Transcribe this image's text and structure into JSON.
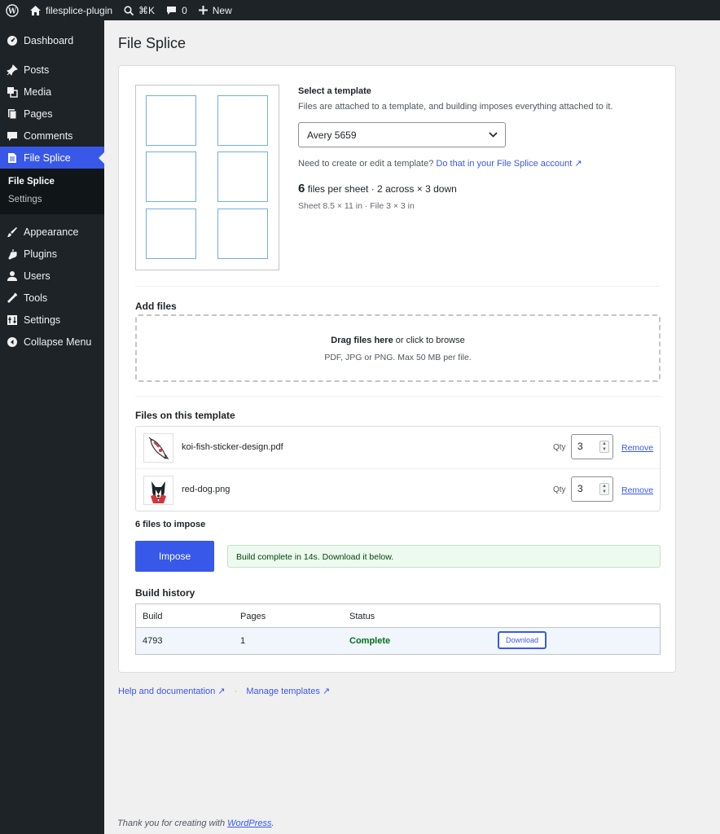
{
  "adminbar": {
    "site_name": "filesplice-plugin",
    "search_shortcut": "⌘K",
    "comments_count": "0",
    "new_label": "New"
  },
  "sidebar": {
    "items": [
      {
        "label": "Dashboard",
        "icon": "dashboard-icon"
      },
      {
        "label": "Posts",
        "icon": "pin-icon"
      },
      {
        "label": "Media",
        "icon": "media-icon"
      },
      {
        "label": "Pages",
        "icon": "pages-icon"
      },
      {
        "label": "Comments",
        "icon": "comment-icon"
      },
      {
        "label": "File Splice",
        "icon": "document-icon",
        "current": true
      },
      {
        "label": "Appearance",
        "icon": "brush-icon"
      },
      {
        "label": "Plugins",
        "icon": "plug-icon"
      },
      {
        "label": "Users",
        "icon": "user-icon"
      },
      {
        "label": "Tools",
        "icon": "wrench-icon"
      },
      {
        "label": "Settings",
        "icon": "settings-icon"
      },
      {
        "label": "Collapse Menu",
        "icon": "collapse-icon"
      }
    ],
    "submenu": [
      {
        "label": "File Splice",
        "active": true
      },
      {
        "label": "Settings",
        "active": false
      }
    ]
  },
  "page": {
    "title": "File Splice"
  },
  "template": {
    "heading": "Select a template",
    "description": "Files are attached to a template, and building imposes everything attached to it.",
    "selected": "Avery 5659",
    "need_text": "Need to create or edit a template?",
    "need_link": "Do that in your File Splice account ↗",
    "files_per_sheet": "6",
    "per_sheet_text": "files per sheet · 2 across × 3 down",
    "sheet_info": "Sheet 8.5 × 11 in · File 3 × 3 in"
  },
  "add_files": {
    "title": "Add files",
    "drop_bold": "Drag files here",
    "drop_rest": " or click to browse",
    "drop_hint": "PDF, JPG or PNG. Max 50 MB per file."
  },
  "files_section": {
    "title": "Files on this template",
    "qty_label": "Qty",
    "remove_label": "Remove",
    "files": [
      {
        "name": "koi-fish-sticker-design.pdf",
        "qty": "3"
      },
      {
        "name": "red-dog.png",
        "qty": "3"
      }
    ],
    "count_text": "6 files to impose"
  },
  "build": {
    "impose_label": "Impose",
    "notice": "Build complete in 14s. Download it below."
  },
  "history": {
    "title": "Build history",
    "columns": [
      "Build",
      "Pages",
      "Status"
    ],
    "rows": [
      {
        "build": "4793",
        "pages": "1",
        "status": "Complete",
        "action": "Download"
      }
    ]
  },
  "links": {
    "help": "Help and documentation ↗",
    "templates": "Manage templates ↗"
  },
  "footer": {
    "text": "Thank you for creating with ",
    "link": "WordPress",
    "end": "."
  },
  "colors": {
    "accent": "#3858e9",
    "admin_dark": "#1d2327",
    "success_text": "#007017"
  }
}
